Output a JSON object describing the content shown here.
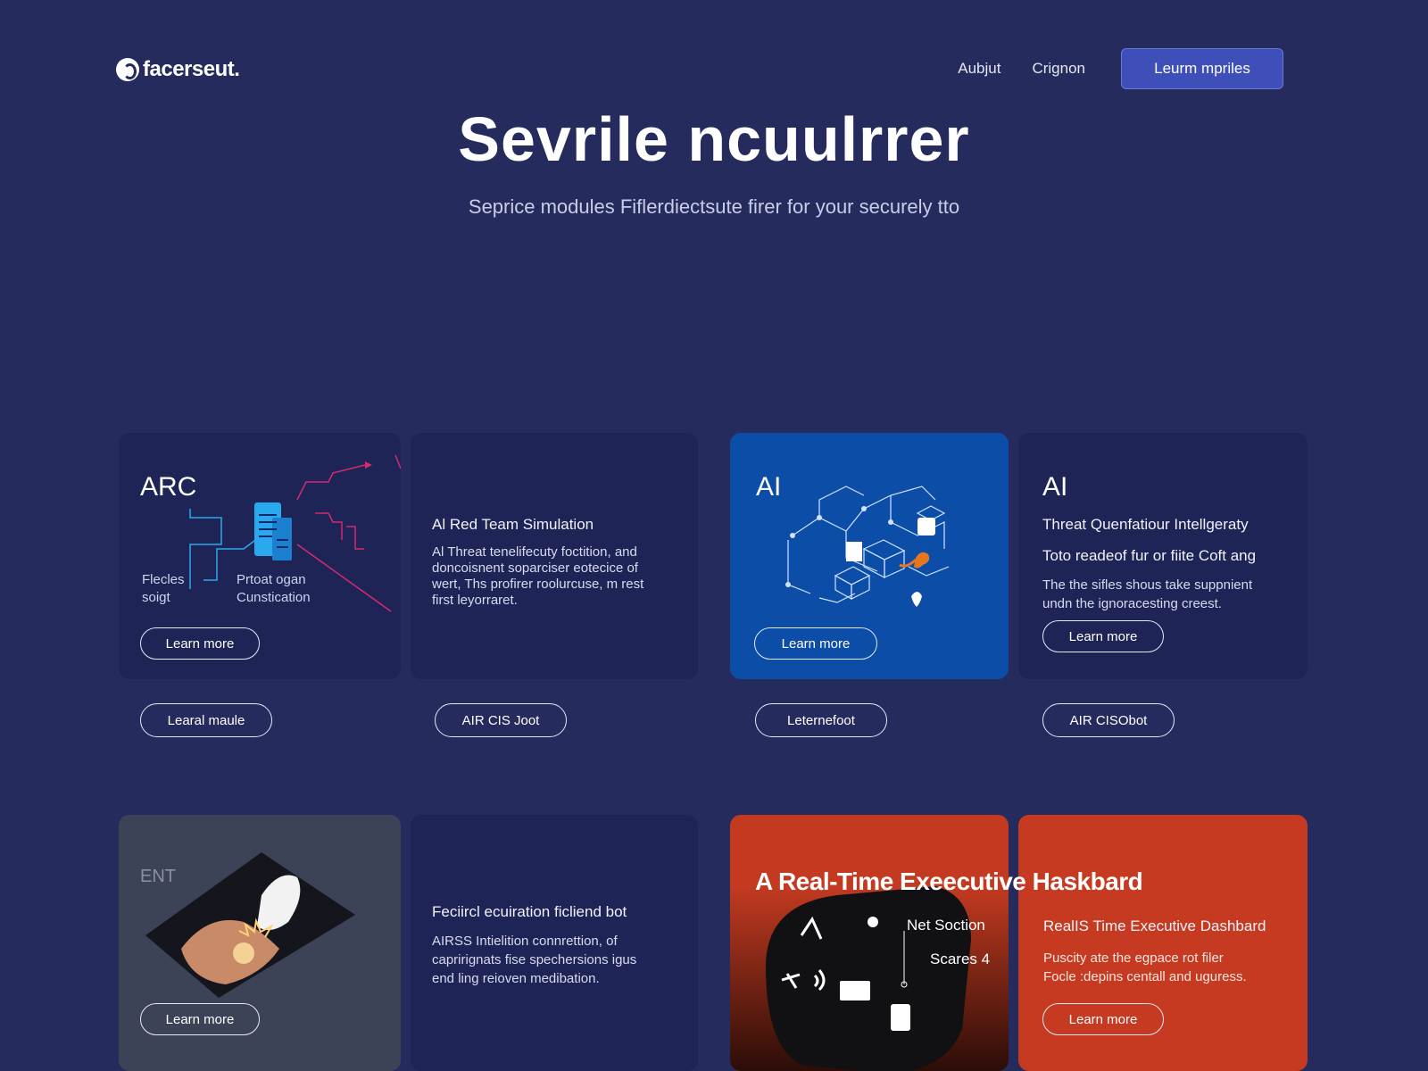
{
  "header": {
    "logo": "facerseut.",
    "nav": [
      "Aubjut",
      "Crignon"
    ],
    "cta": "Leurm mpriles"
  },
  "hero": {
    "title": "Sevrile ncuulrrer",
    "subtitle": "Seprice modules Fiflerdiectsute firer for your securely tto"
  },
  "cards_row1": {
    "arc": {
      "tag": "ARC",
      "label_left_1": "Flecles",
      "label_left_2": "soigt",
      "label_right_1": "Prtoat ogan",
      "label_right_2": "Cunstication",
      "button": "Learn more"
    },
    "redteam": {
      "title": "Al Red Team Simulation",
      "body": [
        "Al Threat tenelifecuty foctition, and",
        "doncoisnent soparciser eotecice of",
        "wert, Ths profirer roolurcuse, m rest",
        "first leyorraret."
      ]
    },
    "ai_blue": {
      "tag": "AI",
      "button": "Learn more"
    },
    "ai_intel": {
      "tag": "AI",
      "title": "Threat Quenfatiour Intellgeraty",
      "subtitle": "Toto readeof fur or fiite Coft ang",
      "body": [
        "The the sifles shous take suppnient",
        "undn the ignoracesting creest."
      ],
      "button": "Learn more"
    }
  },
  "row1_buttons": [
    "Learal maule",
    "AIR CIS Joot",
    "Leternefoot",
    "AIR CISObot"
  ],
  "cards_row2": {
    "gray": {
      "tag": "ENT",
      "button": "Learn more"
    },
    "navy": {
      "title": "Feciircl ecuiration ficliend bot",
      "body": [
        "AIRSS Intielition connrettion, of",
        "caprirignats fise spechersions igus",
        "end ling reioven medibation."
      ]
    },
    "exec": {
      "headline": "A Real-Time Exeecutive Haskbard",
      "label_1": "Net Soction",
      "label_2": "Scares 4"
    },
    "exec_right": {
      "title": "RealIS Time Executive Dashbard",
      "body": [
        "Puscity ate the egpace rot filer",
        "Focle :depins centall and uguress."
      ],
      "button": "Learn more"
    }
  },
  "colors": {
    "background": "#252b5c",
    "card_navy": "#1f2456",
    "card_blue": "#0c4ea7",
    "card_orange": "#c63a22",
    "cta": "#3f4fba",
    "accent_pink": "#d42a6e",
    "accent_cyan": "#2aa9ee"
  }
}
